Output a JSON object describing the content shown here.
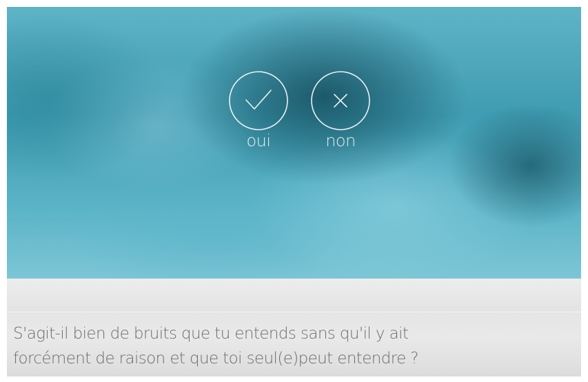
{
  "answers": {
    "yes": {
      "label": "oui",
      "icon": "check-icon"
    },
    "no": {
      "label": "non",
      "icon": "close-icon"
    }
  },
  "question": {
    "line1": "S'agit-il bien de bruits que tu entends sans qu'il y ait",
    "line2": "forcément de raison et que toi seul(e)peut entendre ?"
  },
  "colors": {
    "background_teal": "#3f9cb2",
    "bottom_panel": "#e6e6e6",
    "question_text": "#6d6d6d",
    "icon_stroke": "#ffffff"
  }
}
